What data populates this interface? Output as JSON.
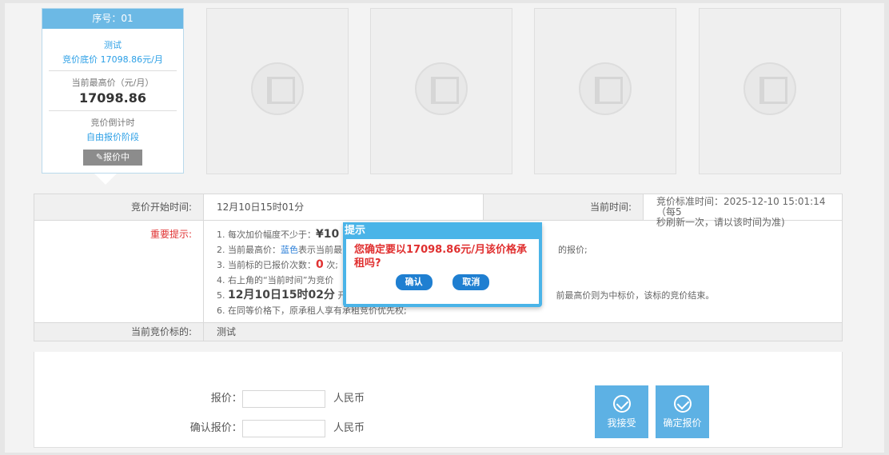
{
  "lot_card": {
    "seq_label": "序号：01",
    "name": "测试",
    "floor_price": "竞价底价 17098.86元/月",
    "current_high_label": "当前最高价（元/月）",
    "current_high_value": "17098.86",
    "countdown_label": "竞价倒计时",
    "phase": "自由报价阶段",
    "status_label": "报价中",
    "status_icon": "pencil-icon"
  },
  "info": {
    "start_label": "竞价开始时间:",
    "start_value": "12月10日15时01分",
    "current_time_label": "当前时间:",
    "standard_time_line1": "竞价标准时间：2025-12-10 15:01:14（每5",
    "standard_time_line2": "秒刷新一次，请以该时间为准)",
    "tips_label": "重要提示:",
    "tip1_prefix": "1. 每次加价幅度不少于：",
    "tip1_value": "¥10",
    "tip2_prefix": "2. 当前最高价：",
    "tip2_blue": "蓝色",
    "tip2_mid": "表示当前最",
    "tip2_tail": "的报价;",
    "tip3_prefix": "3. 当前标的已报价次数：",
    "tip3_count": "0",
    "tip3_suffix": "次;",
    "tip4": "4. 右上角的“当前时间”为竞价",
    "tip5_prefix": "5. ",
    "tip5_bold": "12月10日15时02分",
    "tip5_mid": " 开",
    "tip5_tail": "前最高价则为中标价，该标的竞价结束。",
    "tip6": "6. 在同等价格下，原承租人享有承租竞价优先权;",
    "current_lot_label": "当前竞价标的:",
    "current_lot_value": "测试"
  },
  "bid_form": {
    "price_label": "报价：¥",
    "price_value": "",
    "price_unit": "人民币",
    "confirm_label": "确认报价：¥",
    "confirm_value": "",
    "confirm_unit": "人民币",
    "accept_button": "我接受",
    "submit_button": "确定报价"
  },
  "dialog": {
    "title": "提示",
    "message": "您确定要以17098.86元/月该价格承租吗?",
    "ok_button": "确认",
    "cancel_button": "取消"
  },
  "colors": {
    "accent": "#4ab4e8",
    "alert": "#e03232",
    "link": "#2b9fe6"
  }
}
